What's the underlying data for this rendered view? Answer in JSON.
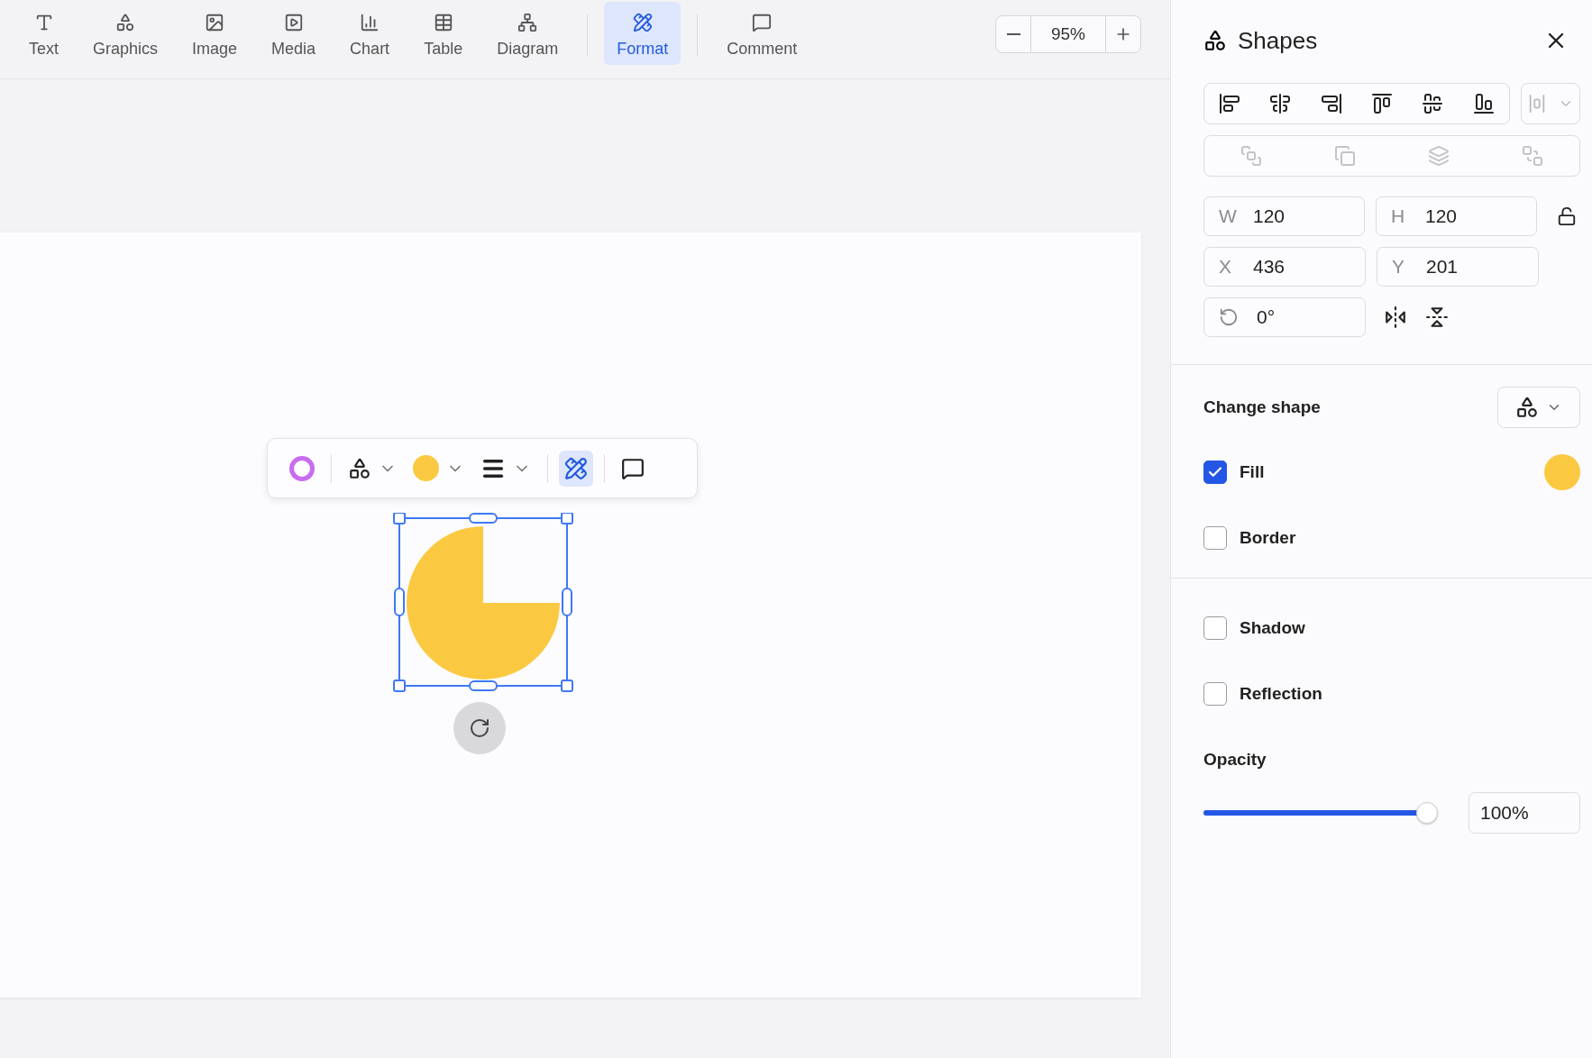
{
  "toolbar": {
    "items": [
      {
        "label": "Text",
        "selected": false
      },
      {
        "label": "Graphics",
        "selected": false
      },
      {
        "label": "Image",
        "selected": false
      },
      {
        "label": "Media",
        "selected": false
      },
      {
        "label": "Chart",
        "selected": false
      },
      {
        "label": "Table",
        "selected": false
      },
      {
        "label": "Diagram",
        "selected": false
      },
      {
        "label": "Format",
        "selected": true
      },
      {
        "label": "Comment",
        "selected": false
      }
    ],
    "zoom": "95%"
  },
  "panel": {
    "title": "Shapes",
    "fields": [
      {
        "label": "W",
        "value": "120"
      },
      {
        "label": "H",
        "value": "120"
      },
      {
        "label": "X",
        "value": "436"
      },
      {
        "label": "Y",
        "value": "201"
      }
    ],
    "rotation": "0°",
    "change_shape": "Change shape",
    "options": [
      {
        "label": "Fill",
        "checked": true,
        "kind": "color"
      },
      {
        "label": "Border",
        "checked": false,
        "kind": "plain"
      },
      {
        "label": "Shadow",
        "checked": false,
        "kind": "plain"
      },
      {
        "label": "Reflection",
        "checked": false,
        "kind": "plain"
      }
    ],
    "opacity": {
      "label": "Opacity",
      "level": 1,
      "value": "100%"
    }
  }
}
